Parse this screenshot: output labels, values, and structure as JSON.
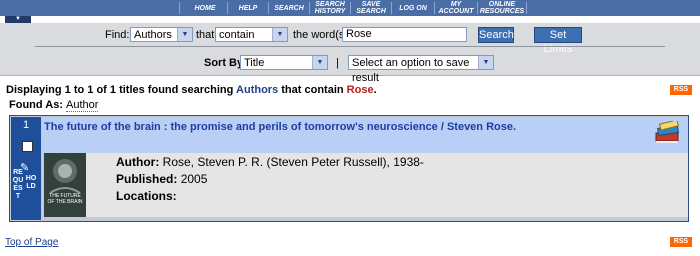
{
  "nav": {
    "items": [
      "HOME",
      "HELP",
      "SEARCH",
      "SEARCH\nHISTORY",
      "SAVE\nSEARCH",
      "LOG ON",
      "MY\nACCOUNT",
      "ONLINE\nRESOURCES"
    ],
    "tab_glyph": "▼"
  },
  "search": {
    "find_label": "Find:",
    "field_value": "Authors",
    "that_label": "that",
    "condition_value": "contain",
    "words_label": "the word(s)",
    "query_value": "Rose",
    "search_button": "Search",
    "limits_button": "Set Limits"
  },
  "sort": {
    "label": "Sort By:",
    "value": "Title",
    "separator": "|",
    "save_option": "Select an option to save result"
  },
  "summary": {
    "prefix": "Displaying 1 to 1 of 1 titles found searching",
    "field": "Authors",
    "middle": "that contain",
    "term": "Rose",
    "suffix": "."
  },
  "rss_label": "RSS",
  "found_as": {
    "label": "Found As:",
    "value": "Author"
  },
  "result": {
    "number": "1",
    "request_text": "REQUEST",
    "hold_text": "HOLD",
    "title": "The future of the brain : the promise and perils of tomorrow's neuroscience / Steven Rose.",
    "cover_caption": "THE FUTURE OF THE BRAIN",
    "author_label": "Author:",
    "author_value": "Rose, Steven P. R. (Steven Peter Russell), 1938-",
    "published_label": "Published:",
    "published_value": "2005",
    "locations_label": "Locations:"
  },
  "footer": {
    "top_link": "Top of Page"
  }
}
